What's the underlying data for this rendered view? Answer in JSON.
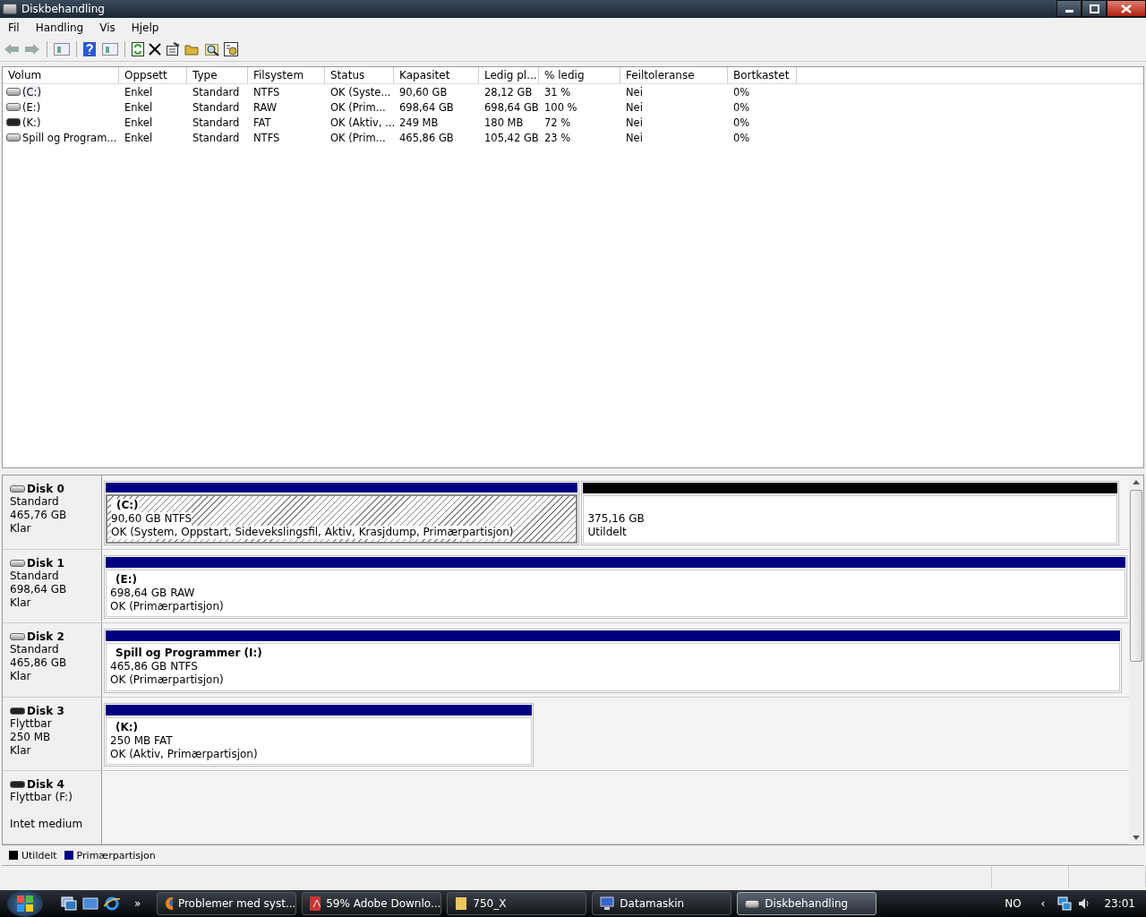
{
  "window": {
    "title": "Diskbehandling"
  },
  "menu": [
    "Fil",
    "Handling",
    "Vis",
    "Hjelp"
  ],
  "table": {
    "columns": [
      "Volum",
      "Oppsett",
      "Type",
      "Filsystem",
      "Status",
      "Kapasitet",
      "Ledig pl...",
      "% ledig",
      "Feiltoleranse",
      "Bortkastet"
    ],
    "rows": [
      {
        "kind": "fixed",
        "selected": true,
        "cells": [
          "(C:)",
          "Enkel",
          "Standard",
          "NTFS",
          "OK (Syste...",
          "90,60 GB",
          "28,12 GB",
          "31 %",
          "Nei",
          "0%"
        ]
      },
      {
        "kind": "fixed",
        "selected": false,
        "cells": [
          "(E:)",
          "Enkel",
          "Standard",
          "RAW",
          "OK (Prim...",
          "698,64 GB",
          "698,64 GB",
          "100 %",
          "Nei",
          "0%"
        ]
      },
      {
        "kind": "removable",
        "selected": false,
        "cells": [
          "(K:)",
          "Enkel",
          "Standard",
          "FAT",
          "OK (Aktiv, ...",
          "249 MB",
          "180 MB",
          "72 %",
          "Nei",
          "0%"
        ]
      },
      {
        "kind": "fixed",
        "selected": false,
        "cells": [
          "Spill og Program...",
          "Enkel",
          "Standard",
          "NTFS",
          "OK (Prim...",
          "465,86 GB",
          "105,42 GB",
          "23 %",
          "Nei",
          "0%"
        ]
      }
    ]
  },
  "disks": [
    {
      "kind": "fixed",
      "name": "Disk 0",
      "type": "Standard",
      "size": "465,76 GB",
      "state": "Klar",
      "partitions": [
        {
          "kind": "primary",
          "selected": true,
          "label": "(C:)",
          "size": "90,60 GB NTFS",
          "status": "OK (System, Oppstart, Sidevekslingsfil, Aktiv, Krasjdump, Primærpartisjon)"
        },
        {
          "kind": "unallocated",
          "selected": false,
          "size": "375,16 GB",
          "status": "Utildelt"
        }
      ]
    },
    {
      "kind": "fixed",
      "name": "Disk 1",
      "type": "Standard",
      "size": "698,64 GB",
      "state": "Klar",
      "partitions": [
        {
          "kind": "primary",
          "selected": false,
          "label": "(E:)",
          "size": "698,64 GB RAW",
          "status": "OK (Primærpartisjon)"
        }
      ]
    },
    {
      "kind": "fixed",
      "name": "Disk 2",
      "type": "Standard",
      "size": "465,86 GB",
      "state": "Klar",
      "partitions": [
        {
          "kind": "primary",
          "selected": false,
          "label": "Spill og Programmer  (I:)",
          "size": "465,86 GB NTFS",
          "status": "OK (Primærpartisjon)"
        }
      ]
    },
    {
      "kind": "removable",
      "name": "Disk 3",
      "type": "Flyttbar",
      "size": "250 MB",
      "state": "Klar",
      "partitions": [
        {
          "kind": "primary",
          "selected": false,
          "label": "(K:)",
          "size": "250 MB FAT",
          "status": "OK (Aktiv, Primærpartisjon)"
        }
      ]
    },
    {
      "kind": "removable",
      "name": "Disk 4",
      "type": "Flyttbar (F:)",
      "state": "Intet medium"
    }
  ],
  "legend": [
    {
      "label": "Utildelt",
      "color": "#000000"
    },
    {
      "label": "Primærpartisjon",
      "color": "#000080"
    }
  ],
  "taskbar": {
    "more": "»",
    "tasks": [
      {
        "kind": "browser",
        "label": "Problemer med syst...",
        "selected": false
      },
      {
        "kind": "pdf",
        "label": "59% Adobe Downlo...",
        "selected": false
      },
      {
        "kind": "folder",
        "label": "750_X",
        "selected": false
      },
      {
        "kind": "computer",
        "label": "Datamaskin",
        "selected": false
      },
      {
        "kind": "disk",
        "label": "Diskbehandling",
        "selected": true
      }
    ],
    "language": "NO",
    "tray_toggle": "‹",
    "clock": "23:01"
  }
}
